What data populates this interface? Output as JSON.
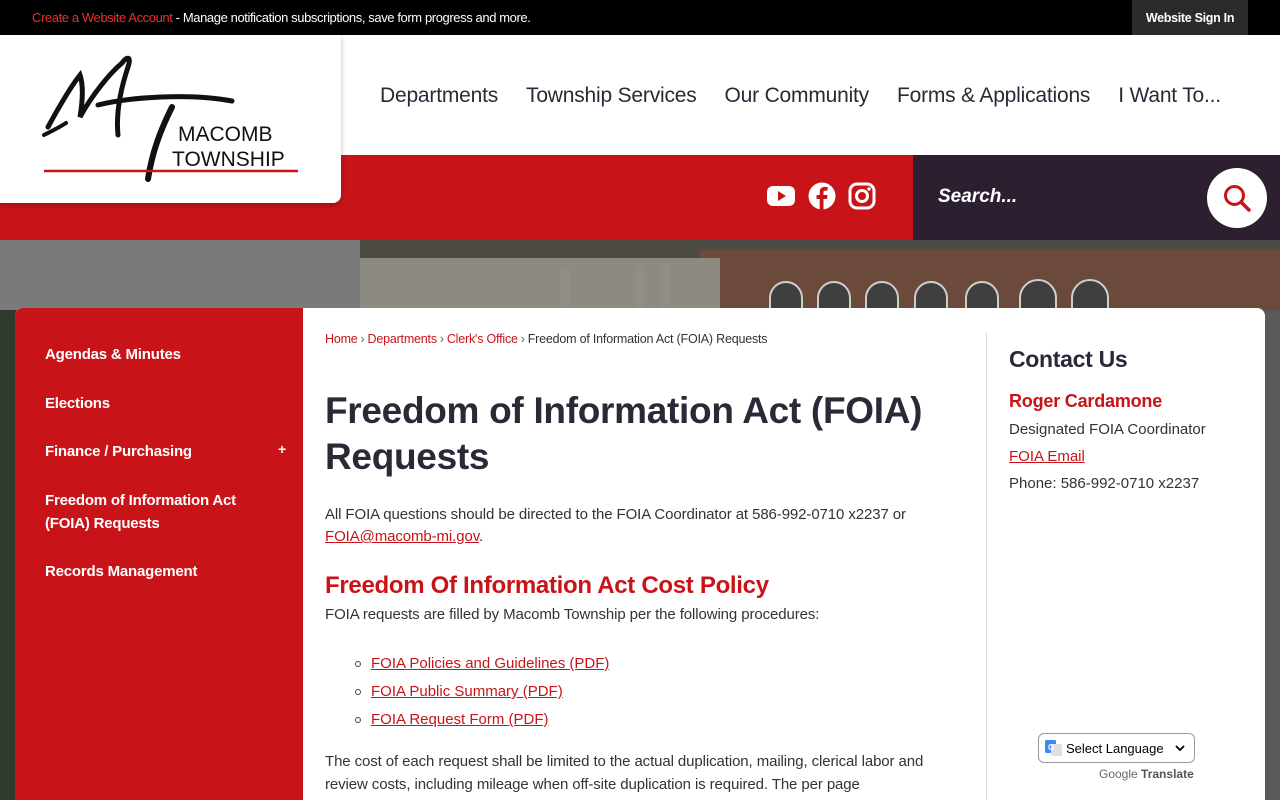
{
  "topbar": {
    "create_account": "Create a Website Account",
    "notice": " - Manage notification subscriptions, save form progress and more.",
    "sign_in": "Website Sign In"
  },
  "logo": {
    "line1": "MACOMB",
    "line2": "TOWNSHIP"
  },
  "nav": [
    "Departments",
    "Township Services",
    "Our Community",
    "Forms & Applications",
    "I Want To..."
  ],
  "social": [
    "youtube-icon",
    "facebook-icon",
    "instagram-icon"
  ],
  "search": {
    "placeholder": "Search..."
  },
  "sidenav": {
    "items": [
      "Agendas & Minutes",
      "Elections",
      "Finance / Purchasing",
      "Freedom of Information Act (FOIA) Requests",
      "Records Management"
    ],
    "expand_glyph": "+"
  },
  "breadcrumb": {
    "home": "Home",
    "departments": "Departments",
    "clerks": "Clerk's Office",
    "current": "Freedom of Information Act (FOIA) Requests",
    "sep": "›"
  },
  "main": {
    "title": "Freedom of Information Act (FOIA) Requests",
    "intro_text": "All FOIA questions should be directed to the FOIA Coordinator at 586-992-0710 x2237 or ",
    "intro_email": "FOIA@macomb-mi.gov",
    "intro_end": ".",
    "policy_heading": "Freedom Of Information Act Cost Policy",
    "procedures": "FOIA requests are filled by Macomb Township per the following procedures:",
    "documents": [
      "FOIA Policies and Guidelines (PDF)",
      "FOIA Public Summary (PDF)",
      "FOIA Request Form (PDF)"
    ],
    "cost_text": "The cost of each request shall be limited to the actual duplication, mailing, clerical labor and review costs, including mileage when off-site duplication is required. The per page"
  },
  "contact": {
    "title": "Contact Us",
    "name": "Roger Cardamone",
    "role": "Designated FOIA Coordinator",
    "email_label": "FOIA Email",
    "phone": "Phone: 586-992-0710 x2237"
  },
  "translate": {
    "select_label": "Select Language",
    "powered_by": "Google",
    "translate": "Translate"
  },
  "colors": {
    "brand_red": "#c81418",
    "dark": "#2d2838",
    "search_bg": "#2c2030"
  }
}
